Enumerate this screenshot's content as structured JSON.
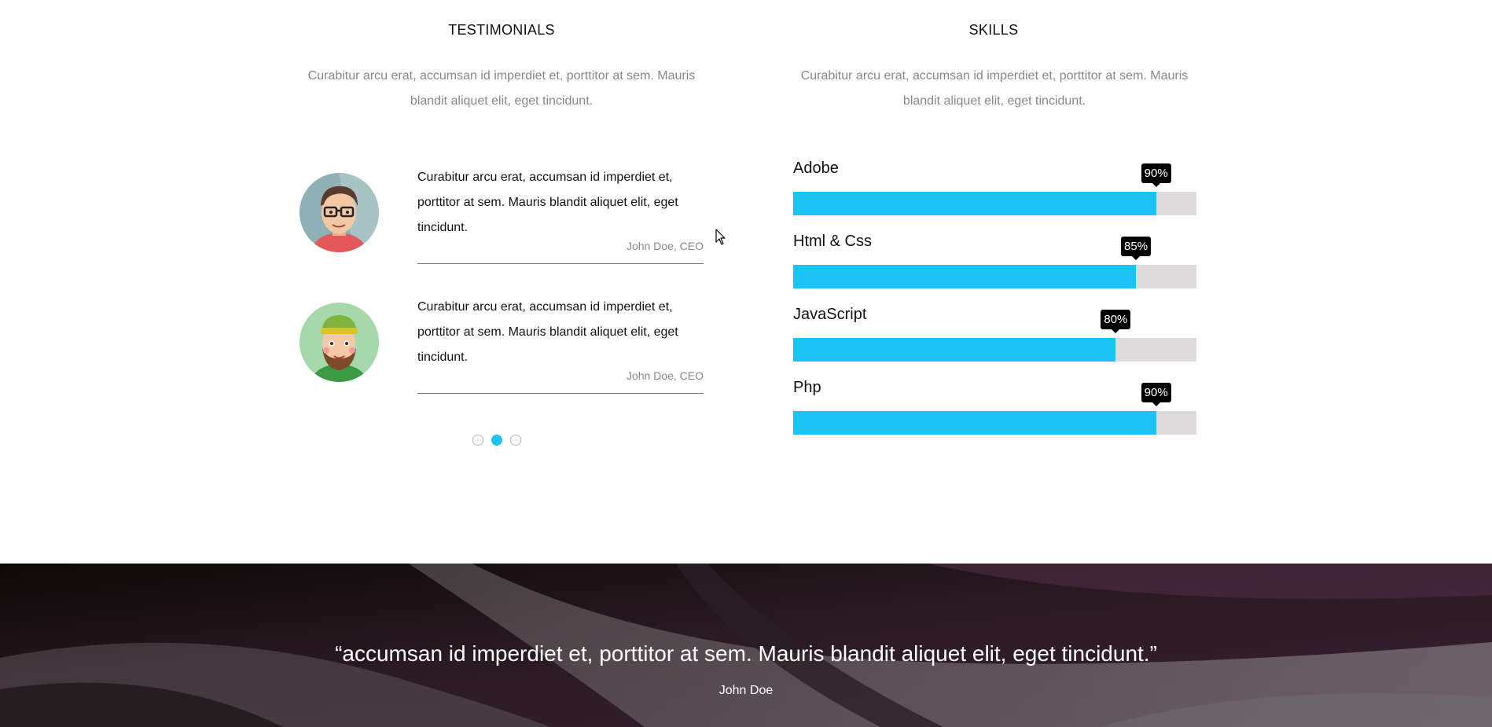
{
  "testimonials": {
    "title": "TESTIMONIALS",
    "intro": "Curabitur arcu erat, accumsan id imperdiet et, porttitor at sem. Mauris blandit aliquet elit, eget tincidunt.",
    "items": [
      {
        "text": "Curabitur arcu erat, accumsan id imperdiet et, porttitor at sem. Mauris blandit aliquet elit, eget tincidunt.",
        "author": "John Doe, CEO",
        "avatar": "man-with-glasses-avatar"
      },
      {
        "text": "Curabitur arcu erat, accumsan id imperdiet et, porttitor at sem. Mauris blandit aliquet elit, eget tincidunt.",
        "author": "John Doe, CEO",
        "avatar": "bearded-man-avatar"
      }
    ],
    "pager": {
      "count": 3,
      "active_index": 1
    }
  },
  "skills": {
    "title": "SKILLS",
    "intro": "Curabitur arcu erat, accumsan id imperdiet et, porttitor at sem. Mauris blandit aliquet elit, eget tincidunt.",
    "items": [
      {
        "name": "Adobe",
        "percent": 90,
        "label": "90%"
      },
      {
        "name": "Html & Css",
        "percent": 85,
        "label": "85%"
      },
      {
        "name": "JavaScript",
        "percent": 80,
        "label": "80%"
      },
      {
        "name": "Php",
        "percent": 90,
        "label": "90%"
      }
    ]
  },
  "quote_band": {
    "quote": "“accumsan id imperdiet et, porttitor at sem. Mauris blandit aliquet elit, eget tincidunt.”",
    "author": "John Doe"
  },
  "colors": {
    "accent": "#1bc3f5",
    "track": "#dcdada",
    "tooltip": "#000000",
    "band_dark": "#1a1216"
  }
}
